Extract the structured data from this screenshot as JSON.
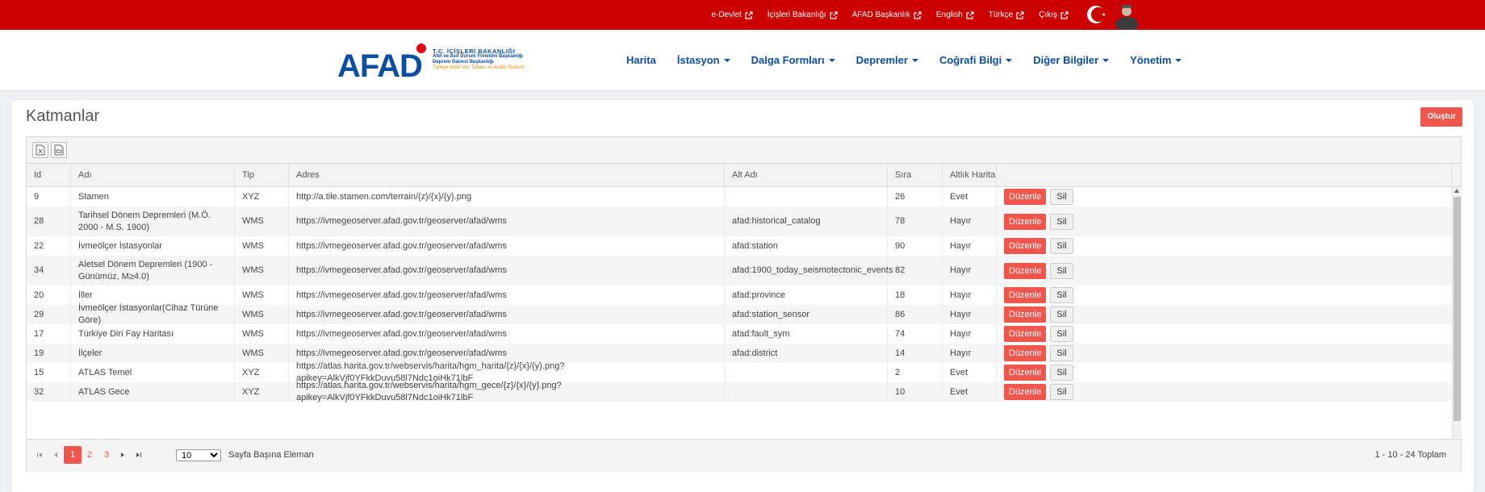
{
  "top_links": [
    {
      "label": "e-Devlet",
      "icon": "external-link-icon"
    },
    {
      "label": "İçişleri Bakanlığı",
      "icon": "external-link-icon"
    },
    {
      "label": "AFAD Başkanlık",
      "icon": "external-link-icon"
    },
    {
      "label": "English",
      "icon": "external-link-icon"
    },
    {
      "label": "Türkçe",
      "icon": "external-link-icon"
    },
    {
      "label": "Çıkış",
      "icon": "external-link-icon"
    }
  ],
  "logo": {
    "word": "AFAD",
    "line1": "T.C. İÇİŞLERİ BAKANLIĞI",
    "line2": "Afet ve Acil Durum Yönetimi Başkanlığı",
    "line3": "Deprem Dairesi Başkanlığı",
    "line4": "Türkiye İvme Veri Tabanı ve Analiz Sistemi"
  },
  "nav": [
    {
      "label": "Harita",
      "dropdown": false
    },
    {
      "label": "İstasyon",
      "dropdown": true
    },
    {
      "label": "Dalga Formları",
      "dropdown": true
    },
    {
      "label": "Depremler",
      "dropdown": true
    },
    {
      "label": "Coğrafi Bilgi",
      "dropdown": true
    },
    {
      "label": "Diğer Bilgiler",
      "dropdown": true
    },
    {
      "label": "Yönetim",
      "dropdown": true
    }
  ],
  "page": {
    "title": "Katmanlar",
    "create_label": "Oluştur"
  },
  "table": {
    "columns": [
      "Id",
      "Adı",
      "Tip",
      "Adres",
      "Alt Adı",
      "Sıra",
      "Altlık Harita",
      ""
    ],
    "edit_label": "Düzenle",
    "delete_label": "Sil",
    "rows": [
      {
        "id": "9",
        "name": "Stamen",
        "type": "XYZ",
        "address": "http://a.tile.stamen.com/terrain/{z}/{x}/{y}.png",
        "sub": "",
        "order": "26",
        "base": "Evet"
      },
      {
        "id": "28",
        "name": "Tarihsel Dönem Depremleri (M.Ö. 2000 - M.S. 1900)",
        "type": "WMS",
        "address": "https://ivmegeoserver.afad.gov.tr/geoserver/afad/wms",
        "sub": "afad:historical_catalog",
        "order": "78",
        "base": "Hayır"
      },
      {
        "id": "22",
        "name": "İvmeölçer İstasyonlar",
        "type": "WMS",
        "address": "https://ivmegeoserver.afad.gov.tr/geoserver/afad/wms",
        "sub": "afad:station",
        "order": "90",
        "base": "Hayır"
      },
      {
        "id": "34",
        "name": "Aletsel Dönem Depremleri (1900 - Günümüz, M≥4.0)",
        "type": "WMS",
        "address": "https://ivmegeoserver.afad.gov.tr/geoserver/afad/wms",
        "sub": "afad:1900_today_seismotectonic_events",
        "order": "82",
        "base": "Hayır"
      },
      {
        "id": "20",
        "name": "İller",
        "type": "WMS",
        "address": "https://ivmegeoserver.afad.gov.tr/geoserver/afad/wms",
        "sub": "afad:province",
        "order": "18",
        "base": "Hayır"
      },
      {
        "id": "29",
        "name": "İvmeölçer İstasyonlar(Cihaz Türüne Göre)",
        "type": "WMS",
        "address": "https://ivmegeoserver.afad.gov.tr/geoserver/afad/wms",
        "sub": "afad:station_sensor",
        "order": "86",
        "base": "Hayır"
      },
      {
        "id": "17",
        "name": "Türkiye Diri Fay Haritası",
        "type": "WMS",
        "address": "https://ivmegeoserver.afad.gov.tr/geoserver/afad/wms",
        "sub": "afad:fault_sym",
        "order": "74",
        "base": "Hayır"
      },
      {
        "id": "19",
        "name": "İlçeler",
        "type": "WMS",
        "address": "https://ivmegeoserver.afad.gov.tr/geoserver/afad/wms",
        "sub": "afad:district",
        "order": "14",
        "base": "Hayır"
      },
      {
        "id": "15",
        "name": "ATLAS Temel",
        "type": "XYZ",
        "address": "https://atlas.harita.gov.tr/webservis/harita/hgm_harita/{z}/{x}/{y}.png?apikey=AlkVjf0YFkkDuvu58l7Ndc1oiHk71lbF",
        "sub": "",
        "order": "2",
        "base": "Evet"
      },
      {
        "id": "32",
        "name": "ATLAS Gece",
        "type": "XYZ",
        "address": "https://atlas.harita.gov.tr/webservis/harita/hgm_gece/{z}/{x}/{y}.png?apikey=AlkVjf0YFkkDuvu58l7Ndc1oiHk71lbF",
        "sub": "",
        "order": "10",
        "base": "Evet"
      }
    ]
  },
  "pager": {
    "pages": [
      "1",
      "2",
      "3"
    ],
    "current": "1",
    "page_size": "10",
    "page_size_label": "Sayfa Başına Eleman",
    "info": "1 - 10 - 24 Toplam"
  },
  "colors": {
    "topbar": "#cc0000",
    "brand_blue": "#0b4ea2",
    "accent": "#f0564b"
  }
}
